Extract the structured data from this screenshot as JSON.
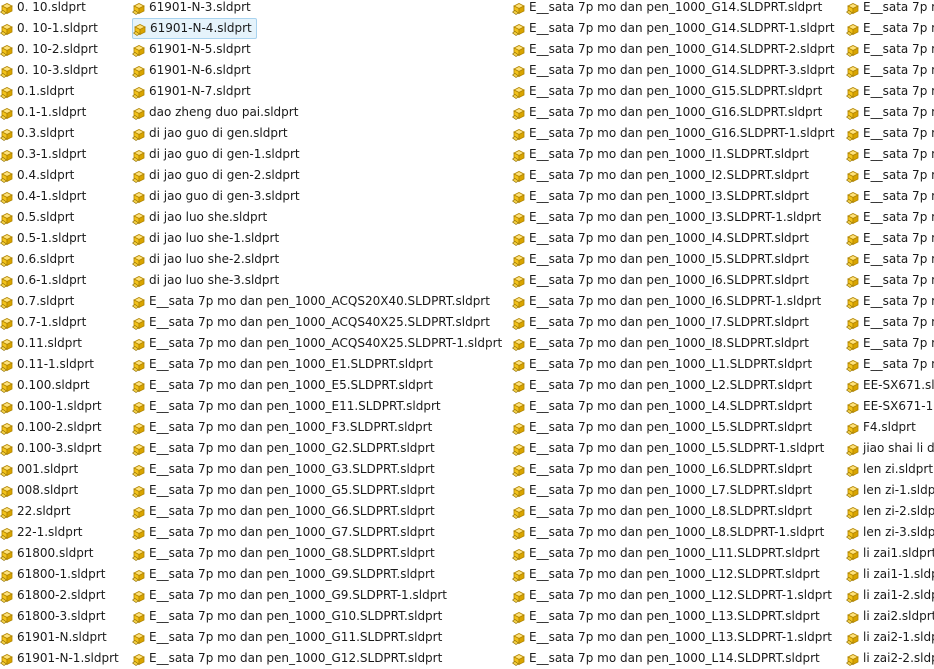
{
  "icon_name": "sldprt-file-icon",
  "colors": {
    "icon_fill": "#f2c21b",
    "icon_stroke": "#b08400",
    "selection_bg": "#e5f3fb",
    "selection_border": "#a9d3ef"
  },
  "columns": [
    {
      "files": [
        "0. 10.sldprt",
        "0. 10-1.sldprt",
        "0. 10-2.sldprt",
        "0. 10-3.sldprt",
        "0.1.sldprt",
        "0.1-1.sldprt",
        "0.3.sldprt",
        "0.3-1.sldprt",
        "0.4.sldprt",
        "0.4-1.sldprt",
        "0.5.sldprt",
        "0.5-1.sldprt",
        "0.6.sldprt",
        "0.6-1.sldprt",
        "0.7.sldprt",
        "0.7-1.sldprt",
        "0.11.sldprt",
        "0.11-1.sldprt",
        "0.100.sldprt",
        "0.100-1.sldprt",
        "0.100-2.sldprt",
        "0.100-3.sldprt",
        "001.sldprt",
        "008.sldprt",
        "22.sldprt",
        "22-1.sldprt",
        "61800.sldprt",
        "61800-1.sldprt",
        "61800-2.sldprt",
        "61800-3.sldprt",
        "61901-N.sldprt",
        "61901-N-1.sldprt"
      ]
    },
    {
      "files": [
        "61901-N-3.sldprt",
        "61901-N-4.sldprt",
        "61901-N-5.sldprt",
        "61901-N-6.sldprt",
        "61901-N-7.sldprt",
        "dao zheng duo pai.sldprt",
        "di jao guo di gen.sldprt",
        "di jao guo di gen-1.sldprt",
        "di jao guo di gen-2.sldprt",
        "di jao guo di gen-3.sldprt",
        "di jao luo she.sldprt",
        "di jao luo she-1.sldprt",
        "di jao luo she-2.sldprt",
        "di jao luo she-3.sldprt",
        "E__sata 7p mo dan  pen_1000_ACQS20X40.SLDPRT.sldprt",
        "E__sata 7p mo dan  pen_1000_ACQS40X25.SLDPRT.sldprt",
        "E__sata 7p mo dan  pen_1000_ACQS40X25.SLDPRT-1.sldprt",
        "E__sata 7p mo dan  pen_1000_E1.SLDPRT.sldprt",
        "E__sata 7p mo dan  pen_1000_E5.SLDPRT.sldprt",
        "E__sata 7p mo dan  pen_1000_E11.SLDPRT.sldprt",
        "E__sata 7p mo dan  pen_1000_F3.SLDPRT.sldprt",
        "E__sata 7p mo dan  pen_1000_G2.SLDPRT.sldprt",
        "E__sata 7p mo dan  pen_1000_G3.SLDPRT.sldprt",
        "E__sata 7p mo dan  pen_1000_G5.SLDPRT.sldprt",
        "E__sata 7p mo dan  pen_1000_G6.SLDPRT.sldprt",
        "E__sata 7p mo dan  pen_1000_G7.SLDPRT.sldprt",
        "E__sata 7p mo dan  pen_1000_G8.SLDPRT.sldprt",
        "E__sata 7p mo dan  pen_1000_G9.SLDPRT.sldprt",
        "E__sata 7p mo dan  pen_1000_G9.SLDPRT-1.sldprt",
        "E__sata 7p mo dan  pen_1000_G10.SLDPRT.sldprt",
        "E__sata 7p mo dan  pen_1000_G11.SLDPRT.sldprt",
        "E__sata 7p mo dan  pen_1000_G12.SLDPRT.sldprt"
      ],
      "selected_index": 1
    },
    {
      "files": [
        "E__sata 7p mo dan  pen_1000_G14.SLDPRT.sldprt",
        "E__sata 7p mo dan  pen_1000_G14.SLDPRT-1.sldprt",
        "E__sata 7p mo dan  pen_1000_G14.SLDPRT-2.sldprt",
        "E__sata 7p mo dan  pen_1000_G14.SLDPRT-3.sldprt",
        "E__sata 7p mo dan  pen_1000_G15.SLDPRT.sldprt",
        "E__sata 7p mo dan  pen_1000_G16.SLDPRT.sldprt",
        "E__sata 7p mo dan  pen_1000_G16.SLDPRT-1.sldprt",
        "E__sata 7p mo dan  pen_1000_I1.SLDPRT.sldprt",
        "E__sata 7p mo dan  pen_1000_I2.SLDPRT.sldprt",
        "E__sata 7p mo dan  pen_1000_I3.SLDPRT.sldprt",
        "E__sata 7p mo dan  pen_1000_I3.SLDPRT-1.sldprt",
        "E__sata 7p mo dan  pen_1000_I4.SLDPRT.sldprt",
        "E__sata 7p mo dan  pen_1000_I5.SLDPRT.sldprt",
        "E__sata 7p mo dan  pen_1000_I6.SLDPRT.sldprt",
        "E__sata 7p mo dan  pen_1000_I6.SLDPRT-1.sldprt",
        "E__sata 7p mo dan  pen_1000_I7.SLDPRT.sldprt",
        "E__sata 7p mo dan  pen_1000_I8.SLDPRT.sldprt",
        "E__sata 7p mo dan  pen_1000_L1.SLDPRT.sldprt",
        "E__sata 7p mo dan  pen_1000_L2.SLDPRT.sldprt",
        "E__sata 7p mo dan  pen_1000_L4.SLDPRT.sldprt",
        "E__sata 7p mo dan  pen_1000_L5.SLDPRT.sldprt",
        "E__sata 7p mo dan  pen_1000_L5.SLDPRT-1.sldprt",
        "E__sata 7p mo dan  pen_1000_L6.SLDPRT.sldprt",
        "E__sata 7p mo dan  pen_1000_L7.SLDPRT.sldprt",
        "E__sata 7p mo dan  pen_1000_L8.SLDPRT.sldprt",
        "E__sata 7p mo dan  pen_1000_L8.SLDPRT-1.sldprt",
        "E__sata 7p mo dan  pen_1000_L11.SLDPRT.sldprt",
        "E__sata 7p mo dan  pen_1000_L12.SLDPRT.sldprt",
        "E__sata 7p mo dan  pen_1000_L12.SLDPRT-1.sldprt",
        "E__sata 7p mo dan  pen_1000_L13.SLDPRT.sldprt",
        "E__sata 7p mo dan  pen_1000_L13.SLDPRT-1.sldprt",
        "E__sata 7p mo dan  pen_1000_L14.SLDPRT.sldprt"
      ]
    },
    {
      "files": [
        "E__sata 7p m",
        "E__sata 7p m",
        "E__sata 7p m",
        "E__sata 7p m",
        "E__sata 7p m",
        "E__sata 7p m",
        "E__sata 7p m",
        "E__sata 7p m",
        "E__sata 7p m",
        "E__sata 7p m",
        "E__sata 7p m",
        "E__sata 7p m",
        "E__sata 7p m",
        "E__sata 7p m",
        "E__sata 7p m",
        "E__sata 7p m",
        "E__sata 7p m",
        "E__sata 7p m",
        "EE-SX671.sl",
        "EE-SX671-1.",
        "F4.sldprt",
        "jiao shai li d",
        "len zi.sldprt",
        "len zi-1.sldp",
        "len zi-2.sldp",
        "len zi-3.sldp",
        "li zai1.sldprt",
        "li zai1-1.sldp",
        "li zai1-2.sldp",
        "li zai2.sldprt",
        "li zai2-1.sldp",
        "li zai2-2.sldp"
      ]
    }
  ]
}
